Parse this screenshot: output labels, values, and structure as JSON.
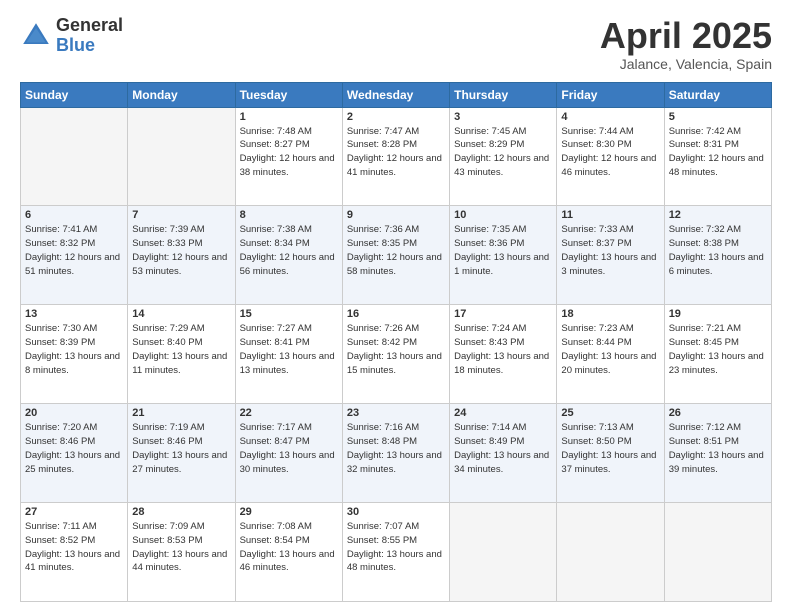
{
  "logo": {
    "general": "General",
    "blue": "Blue"
  },
  "title": {
    "month": "April 2025",
    "location": "Jalance, Valencia, Spain"
  },
  "weekdays": [
    "Sunday",
    "Monday",
    "Tuesday",
    "Wednesday",
    "Thursday",
    "Friday",
    "Saturday"
  ],
  "weeks": [
    [
      {
        "day": "",
        "info": ""
      },
      {
        "day": "",
        "info": ""
      },
      {
        "day": "1",
        "info": "Sunrise: 7:48 AM\nSunset: 8:27 PM\nDaylight: 12 hours and 38 minutes."
      },
      {
        "day": "2",
        "info": "Sunrise: 7:47 AM\nSunset: 8:28 PM\nDaylight: 12 hours and 41 minutes."
      },
      {
        "day": "3",
        "info": "Sunrise: 7:45 AM\nSunset: 8:29 PM\nDaylight: 12 hours and 43 minutes."
      },
      {
        "day": "4",
        "info": "Sunrise: 7:44 AM\nSunset: 8:30 PM\nDaylight: 12 hours and 46 minutes."
      },
      {
        "day": "5",
        "info": "Sunrise: 7:42 AM\nSunset: 8:31 PM\nDaylight: 12 hours and 48 minutes."
      }
    ],
    [
      {
        "day": "6",
        "info": "Sunrise: 7:41 AM\nSunset: 8:32 PM\nDaylight: 12 hours and 51 minutes."
      },
      {
        "day": "7",
        "info": "Sunrise: 7:39 AM\nSunset: 8:33 PM\nDaylight: 12 hours and 53 minutes."
      },
      {
        "day": "8",
        "info": "Sunrise: 7:38 AM\nSunset: 8:34 PM\nDaylight: 12 hours and 56 minutes."
      },
      {
        "day": "9",
        "info": "Sunrise: 7:36 AM\nSunset: 8:35 PM\nDaylight: 12 hours and 58 minutes."
      },
      {
        "day": "10",
        "info": "Sunrise: 7:35 AM\nSunset: 8:36 PM\nDaylight: 13 hours and 1 minute."
      },
      {
        "day": "11",
        "info": "Sunrise: 7:33 AM\nSunset: 8:37 PM\nDaylight: 13 hours and 3 minutes."
      },
      {
        "day": "12",
        "info": "Sunrise: 7:32 AM\nSunset: 8:38 PM\nDaylight: 13 hours and 6 minutes."
      }
    ],
    [
      {
        "day": "13",
        "info": "Sunrise: 7:30 AM\nSunset: 8:39 PM\nDaylight: 13 hours and 8 minutes."
      },
      {
        "day": "14",
        "info": "Sunrise: 7:29 AM\nSunset: 8:40 PM\nDaylight: 13 hours and 11 minutes."
      },
      {
        "day": "15",
        "info": "Sunrise: 7:27 AM\nSunset: 8:41 PM\nDaylight: 13 hours and 13 minutes."
      },
      {
        "day": "16",
        "info": "Sunrise: 7:26 AM\nSunset: 8:42 PM\nDaylight: 13 hours and 15 minutes."
      },
      {
        "day": "17",
        "info": "Sunrise: 7:24 AM\nSunset: 8:43 PM\nDaylight: 13 hours and 18 minutes."
      },
      {
        "day": "18",
        "info": "Sunrise: 7:23 AM\nSunset: 8:44 PM\nDaylight: 13 hours and 20 minutes."
      },
      {
        "day": "19",
        "info": "Sunrise: 7:21 AM\nSunset: 8:45 PM\nDaylight: 13 hours and 23 minutes."
      }
    ],
    [
      {
        "day": "20",
        "info": "Sunrise: 7:20 AM\nSunset: 8:46 PM\nDaylight: 13 hours and 25 minutes."
      },
      {
        "day": "21",
        "info": "Sunrise: 7:19 AM\nSunset: 8:46 PM\nDaylight: 13 hours and 27 minutes."
      },
      {
        "day": "22",
        "info": "Sunrise: 7:17 AM\nSunset: 8:47 PM\nDaylight: 13 hours and 30 minutes."
      },
      {
        "day": "23",
        "info": "Sunrise: 7:16 AM\nSunset: 8:48 PM\nDaylight: 13 hours and 32 minutes."
      },
      {
        "day": "24",
        "info": "Sunrise: 7:14 AM\nSunset: 8:49 PM\nDaylight: 13 hours and 34 minutes."
      },
      {
        "day": "25",
        "info": "Sunrise: 7:13 AM\nSunset: 8:50 PM\nDaylight: 13 hours and 37 minutes."
      },
      {
        "day": "26",
        "info": "Sunrise: 7:12 AM\nSunset: 8:51 PM\nDaylight: 13 hours and 39 minutes."
      }
    ],
    [
      {
        "day": "27",
        "info": "Sunrise: 7:11 AM\nSunset: 8:52 PM\nDaylight: 13 hours and 41 minutes."
      },
      {
        "day": "28",
        "info": "Sunrise: 7:09 AM\nSunset: 8:53 PM\nDaylight: 13 hours and 44 minutes."
      },
      {
        "day": "29",
        "info": "Sunrise: 7:08 AM\nSunset: 8:54 PM\nDaylight: 13 hours and 46 minutes."
      },
      {
        "day": "30",
        "info": "Sunrise: 7:07 AM\nSunset: 8:55 PM\nDaylight: 13 hours and 48 minutes."
      },
      {
        "day": "",
        "info": ""
      },
      {
        "day": "",
        "info": ""
      },
      {
        "day": "",
        "info": ""
      }
    ]
  ]
}
